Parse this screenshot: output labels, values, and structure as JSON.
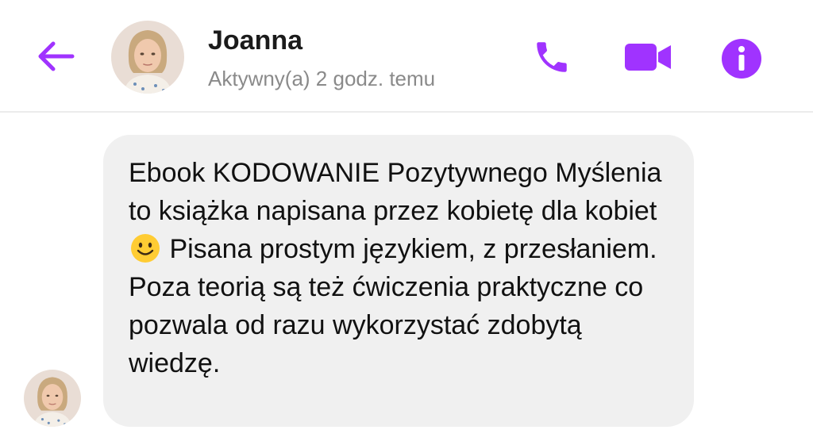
{
  "header": {
    "contact_name": "Joanna",
    "status": "Aktywny(a) 2 godz. temu",
    "back_icon": "arrow-left-icon",
    "call_icon": "phone-icon",
    "video_icon": "video-camera-icon",
    "info_icon": "info-icon"
  },
  "message": {
    "text_before_emoji": "Ebook KODOWANIE Pozytywnego Myślenia to książka napisana przez kobietę dla kobiet",
    "emoji_icon": "smiling-face-emoji",
    "text_after_emoji": "Pisana prostym językiem, z przesłaniem. Poza teorią są też ćwiczenia praktyczne co pozwala od razu wykorzystać zdobytą wiedzę."
  },
  "colors": {
    "accent": "#a033ff",
    "bubble": "#f0f0f0",
    "status_text": "#8a8a8a",
    "name_text": "#1b1b1b"
  }
}
